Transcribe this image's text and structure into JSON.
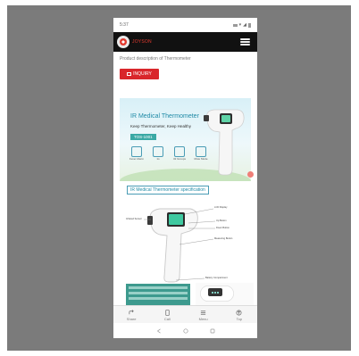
{
  "status_bar": {
    "time": "5:37",
    "signal_icons": [
      "sim-icon",
      "wifi-icon",
      "signal-icon",
      "battery-icon"
    ]
  },
  "header": {
    "brand_name": "JOYSON",
    "menu_icon": "hamburger-menu-icon"
  },
  "page": {
    "product_description": "Product description of Thermometer",
    "inquiry_label": "INQUIRY"
  },
  "banner": {
    "title": "IR Medical Thermometer",
    "subtitle": "Keep Thermometer, Keep Healthy",
    "model": "TOS-1001",
    "features": [
      {
        "icon": "fever-alarm-icon",
        "label": "Fever Alarm"
      },
      {
        "icon": "one-second-icon",
        "label": "1s"
      },
      {
        "icon": "memory-icon",
        "label": "32 Groups"
      },
      {
        "icon": "mute-icon",
        "label": "Mute Mode"
      }
    ]
  },
  "spec": {
    "heading": "IR Medical Thermometer specification",
    "labels": {
      "lcd": "LCD Display",
      "probe": "Infrared Sensor",
      "button1": "Up Button",
      "button2": "Down Button",
      "trigger": "Measuring Button",
      "battery": "Battery Compartment"
    }
  },
  "bottom_nav": [
    {
      "icon": "share-icon",
      "label": "Share"
    },
    {
      "icon": "phone-icon",
      "label": "Call"
    },
    {
      "icon": "menu-grid-icon",
      "label": "Menu"
    },
    {
      "icon": "top-arrow-icon",
      "label": "Top"
    }
  ],
  "colors": {
    "accent": "#d9262b",
    "brand_teal": "#1f8aa6",
    "topbar": "#111111"
  }
}
